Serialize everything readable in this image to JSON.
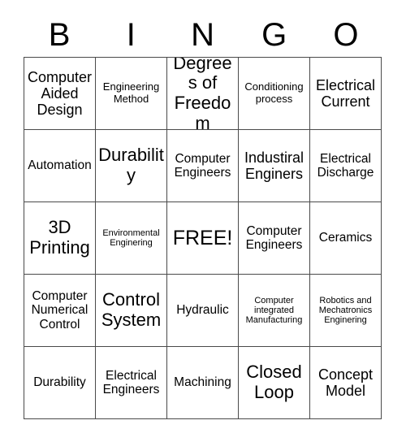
{
  "card": {
    "title_letters": [
      "B",
      "I",
      "N",
      "G",
      "O"
    ],
    "free_space_label": "FREE!",
    "columns": 5,
    "rows": 5,
    "text_color": "#000000",
    "border_color": "#4a4a4a",
    "background_color": "#ffffff",
    "cells": [
      [
        {
          "text": "Computer Aided Design",
          "size": "lg"
        },
        {
          "text": "Engineering Method",
          "size": "sm"
        },
        {
          "text": "Degrees of Freedom",
          "size": "xl"
        },
        {
          "text": "Conditioning process",
          "size": "sm"
        },
        {
          "text": "Electrical Current",
          "size": "lg"
        }
      ],
      [
        {
          "text": "Automation",
          "size": "md"
        },
        {
          "text": "Durability",
          "size": "xl"
        },
        {
          "text": "Computer Engineers",
          "size": "md"
        },
        {
          "text": "Industiral Enginers",
          "size": "lg"
        },
        {
          "text": "Electrical Discharge",
          "size": "md"
        }
      ],
      [
        {
          "text": "3D Printing",
          "size": "xl"
        },
        {
          "text": "Environmental Enginering",
          "size": "xs"
        },
        {
          "text": "FREE!",
          "size": "xxl"
        },
        {
          "text": "Computer Engineers",
          "size": "md"
        },
        {
          "text": "Ceramics",
          "size": "md"
        }
      ],
      [
        {
          "text": "Computer Numerical Control",
          "size": "md"
        },
        {
          "text": "Control System",
          "size": "xl"
        },
        {
          "text": "Hydraulic",
          "size": "md"
        },
        {
          "text": "Computer integrated Manufacturing",
          "size": "xs"
        },
        {
          "text": "Robotics and Mechatronics Enginering",
          "size": "xs"
        }
      ],
      [
        {
          "text": "Durability",
          "size": "md"
        },
        {
          "text": "Electrical Engineers",
          "size": "md"
        },
        {
          "text": "Machining",
          "size": "md"
        },
        {
          "text": "Closed Loop",
          "size": "xl"
        },
        {
          "text": "Concept Model",
          "size": "lg"
        }
      ]
    ]
  }
}
